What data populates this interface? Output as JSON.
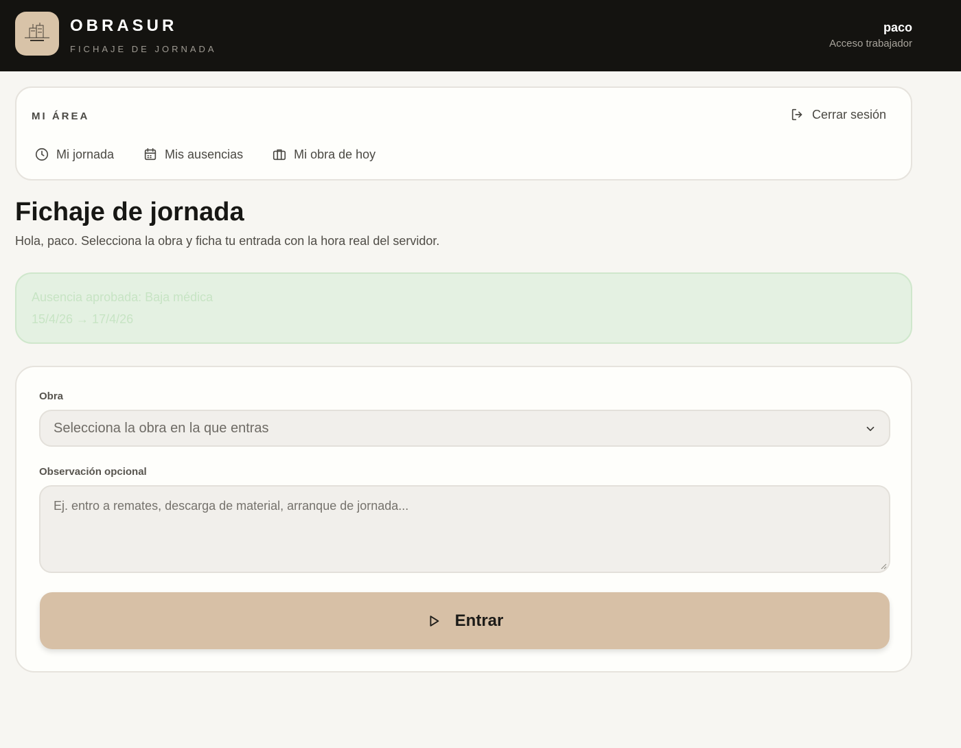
{
  "header": {
    "brand_name": "OBRASUR",
    "brand_subtitle": "FICHAJE DE JORNADA",
    "user_name": "paco",
    "user_role": "Acceso trabajador",
    "logo_icon": "building-blueprint-icon"
  },
  "area": {
    "title": "MI ÁREA",
    "logout_label": "Cerrar sesión",
    "logout_icon": "logout-icon",
    "nav": [
      {
        "label": "Mi jornada",
        "icon": "clock-icon"
      },
      {
        "label": "Mis ausencias",
        "icon": "calendar-icon"
      },
      {
        "label": "Mi obra de hoy",
        "icon": "briefcase-icon"
      }
    ]
  },
  "page": {
    "title": "Fichaje de jornada",
    "subtitle": "Hola, paco. Selecciona la obra y ficha tu entrada con la hora real del servidor."
  },
  "absence": {
    "title": "Ausencia aprobada: Baja médica",
    "dates": "15/4/26 → 17/4/26"
  },
  "form": {
    "obra_label": "Obra",
    "obra_placeholder": "Selecciona la obra en la que entras",
    "observation_label": "Observación opcional",
    "observation_placeholder": "Ej. entro a remates, descarga de material, arranque de jornada...",
    "submit_label": "Entrar",
    "submit_icon": "play-icon"
  },
  "colors": {
    "header_bg": "#141310",
    "accent": "#d7c0a6",
    "success_bg": "#e4f1e2",
    "page_bg": "#f7f6f2"
  }
}
